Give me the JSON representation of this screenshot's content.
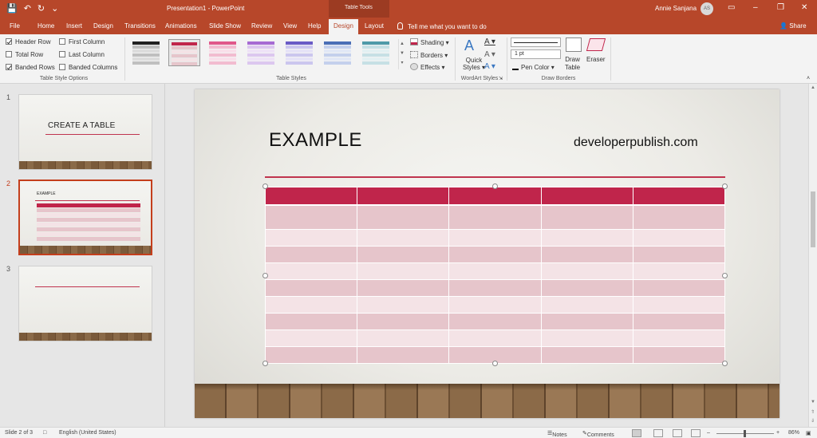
{
  "titlebar": {
    "doc_title": "Presentation1  -  PowerPoint",
    "tools_title": "Table Tools",
    "user_name": "Annie Sanjana",
    "user_initials": "AS",
    "qat": {
      "save": "💾",
      "undo": "↶",
      "redo": "↻",
      "customize": "⌄"
    },
    "window": {
      "minimize": "–",
      "restore": "❐",
      "close": "✕",
      "ribbon_display": "▭"
    }
  },
  "tabs": [
    {
      "label": "File"
    },
    {
      "label": "Home"
    },
    {
      "label": "Insert"
    },
    {
      "label": "Design"
    },
    {
      "label": "Transitions"
    },
    {
      "label": "Animations"
    },
    {
      "label": "Slide Show"
    },
    {
      "label": "Review"
    },
    {
      "label": "View"
    },
    {
      "label": "Help"
    },
    {
      "label": "Design"
    },
    {
      "label": "Layout"
    }
  ],
  "active_tab_index": 10,
  "tell_me": "Tell me what you want to do",
  "share": "Share",
  "ribbon": {
    "style_options": {
      "label": "Table Style Options",
      "checks": [
        {
          "label": "Header Row",
          "checked": true
        },
        {
          "label": "First Column",
          "checked": false
        },
        {
          "label": "Total Row",
          "checked": false
        },
        {
          "label": "Last Column",
          "checked": false
        },
        {
          "label": "Banded Rows",
          "checked": true
        },
        {
          "label": "Banded Columns",
          "checked": false
        }
      ]
    },
    "table_styles": {
      "label": "Table Styles",
      "thumbs": [
        {
          "header": "#222222",
          "band": "#bfbfbf",
          "band2": "#dcdcdc"
        },
        {
          "header": "#c0254b",
          "band": "#e6c5cb",
          "band2": "#f4e3e6",
          "selected": true
        },
        {
          "header": "#e0588a",
          "band": "#f2bcd0",
          "band2": "#f9e0ea"
        },
        {
          "header": "#a66bd3",
          "band": "#dcc7ef",
          "band2": "#eee3f7"
        },
        {
          "header": "#6a5bc6",
          "band": "#cbc6ee",
          "band2": "#e6e3f7"
        },
        {
          "header": "#4b6fb6",
          "band": "#c4d0ec",
          "band2": "#e2e8f6"
        },
        {
          "header": "#4f9aa8",
          "band": "#c6e0e5",
          "band2": "#e3f0f2"
        }
      ],
      "shading": "Shading",
      "borders": "Borders",
      "effects": "Effects"
    },
    "wordart": {
      "label": "WordArt Styles",
      "quick_styles_line1": "Quick",
      "quick_styles_line2": "Styles"
    },
    "draw_borders": {
      "label": "Draw Borders",
      "pen_weight": "1 pt",
      "pen_color": "Pen Color",
      "draw_table_line1": "Draw",
      "draw_table_line2": "Table",
      "eraser": "Eraser"
    }
  },
  "slides": [
    {
      "number": "1",
      "title": "CREATE A TABLE"
    },
    {
      "number": "2",
      "title": "EXAMPLE"
    },
    {
      "number": "3",
      "title": ""
    }
  ],
  "current_slide": {
    "title": "EXAMPLE",
    "subtitle": "developerpublish.com"
  },
  "status": {
    "slide_info": "Slide 2 of 3",
    "language": "English (United States)",
    "notes": "Notes",
    "comments": "Comments",
    "zoom": "86%",
    "zoom_minus": "–",
    "zoom_plus": "+"
  },
  "colors": {
    "accent": "#b7472a",
    "table_header": "#c0254b",
    "table_band": "#e6c5cb",
    "table_band_alt": "#f4e3e6",
    "rule": "#c0344e"
  }
}
